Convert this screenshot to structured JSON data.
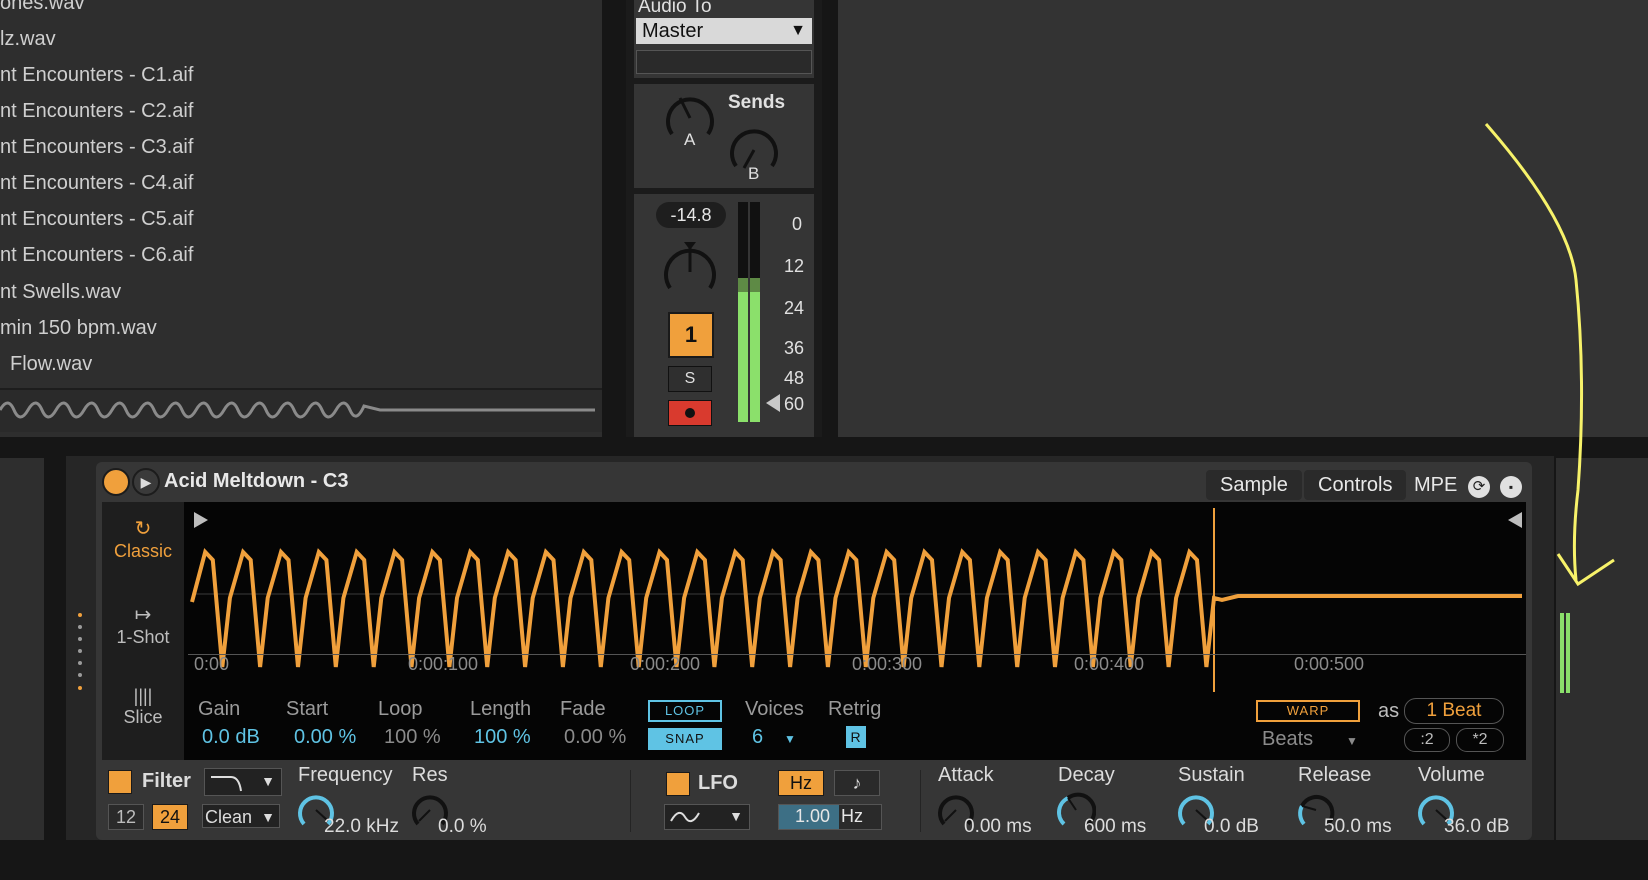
{
  "browser": {
    "files": [
      "ones.wav",
      "lz.wav",
      "nt Encounters - C1.aif",
      "nt Encounters - C2.aif",
      "nt Encounters - C3.aif",
      "nt Encounters - C4.aif",
      "nt Encounters - C5.aif",
      "nt Encounters - C6.aif",
      "nt Swells.wav",
      "min 150 bpm.wav",
      "Flow.wav"
    ]
  },
  "mixer": {
    "audio_to_label": "Audio To",
    "audio_to_value": "Master",
    "sends_label": "Sends",
    "send_a": "A",
    "send_b": "B",
    "volume_readout": "-14.8",
    "track_number": "1",
    "solo_label": "S",
    "meter_scale": [
      "0",
      "12",
      "24",
      "36",
      "48",
      "60"
    ]
  },
  "device": {
    "title": "Acid Meltdown - C3",
    "tabs": [
      "Sample",
      "Controls",
      "MPE"
    ],
    "modes": [
      "Classic",
      "1-Shot",
      "Slice"
    ],
    "timeline": [
      "0:00",
      "0:00:100",
      "0:00:200",
      "0:00:300",
      "0:00:400",
      "0:00:500"
    ],
    "params": {
      "gain_label": "Gain",
      "gain_value": "0.0 dB",
      "start_label": "Start",
      "start_value": "0.00 %",
      "loop_label": "Loop",
      "loop_value": "100 %",
      "length_label": "Length",
      "length_value": "100 %",
      "fade_label": "Fade",
      "fade_value": "0.00 %",
      "loop_btn": "LOOP",
      "snap_btn": "SNAP",
      "voices_label": "Voices",
      "voices_value": "6",
      "retrig_label": "Retrig",
      "retrig_btn": "R",
      "warp_btn": "WARP",
      "as_label": "as",
      "beat_value": "1 Beat",
      "warp_mode": "Beats",
      "half_btn": ":2",
      "double_btn": "*2"
    },
    "filter": {
      "label": "Filter",
      "slope_12": "12",
      "slope_24": "24",
      "type": "Clean",
      "freq_label": "Frequency",
      "freq_value": "22.0 kHz",
      "res_label": "Res",
      "res_value": "0.0 %"
    },
    "lfo": {
      "label": "LFO",
      "hz_btn": "Hz",
      "note_btn": "♪",
      "rate_value": "1.00",
      "rate_unit": "Hz"
    },
    "envelope": {
      "attack_label": "Attack",
      "attack_value": "0.00 ms",
      "decay_label": "Decay",
      "decay_value": "600 ms",
      "sustain_label": "Sustain",
      "sustain_value": "0.0 dB",
      "release_label": "Release",
      "release_value": "50.0 ms",
      "volume_label": "Volume",
      "volume_value": "36.0 dB"
    }
  },
  "colors": {
    "accent": "#f0a03c",
    "blue": "#5fc3e4",
    "meter": "#8be06b",
    "arm": "#d93a2e"
  }
}
